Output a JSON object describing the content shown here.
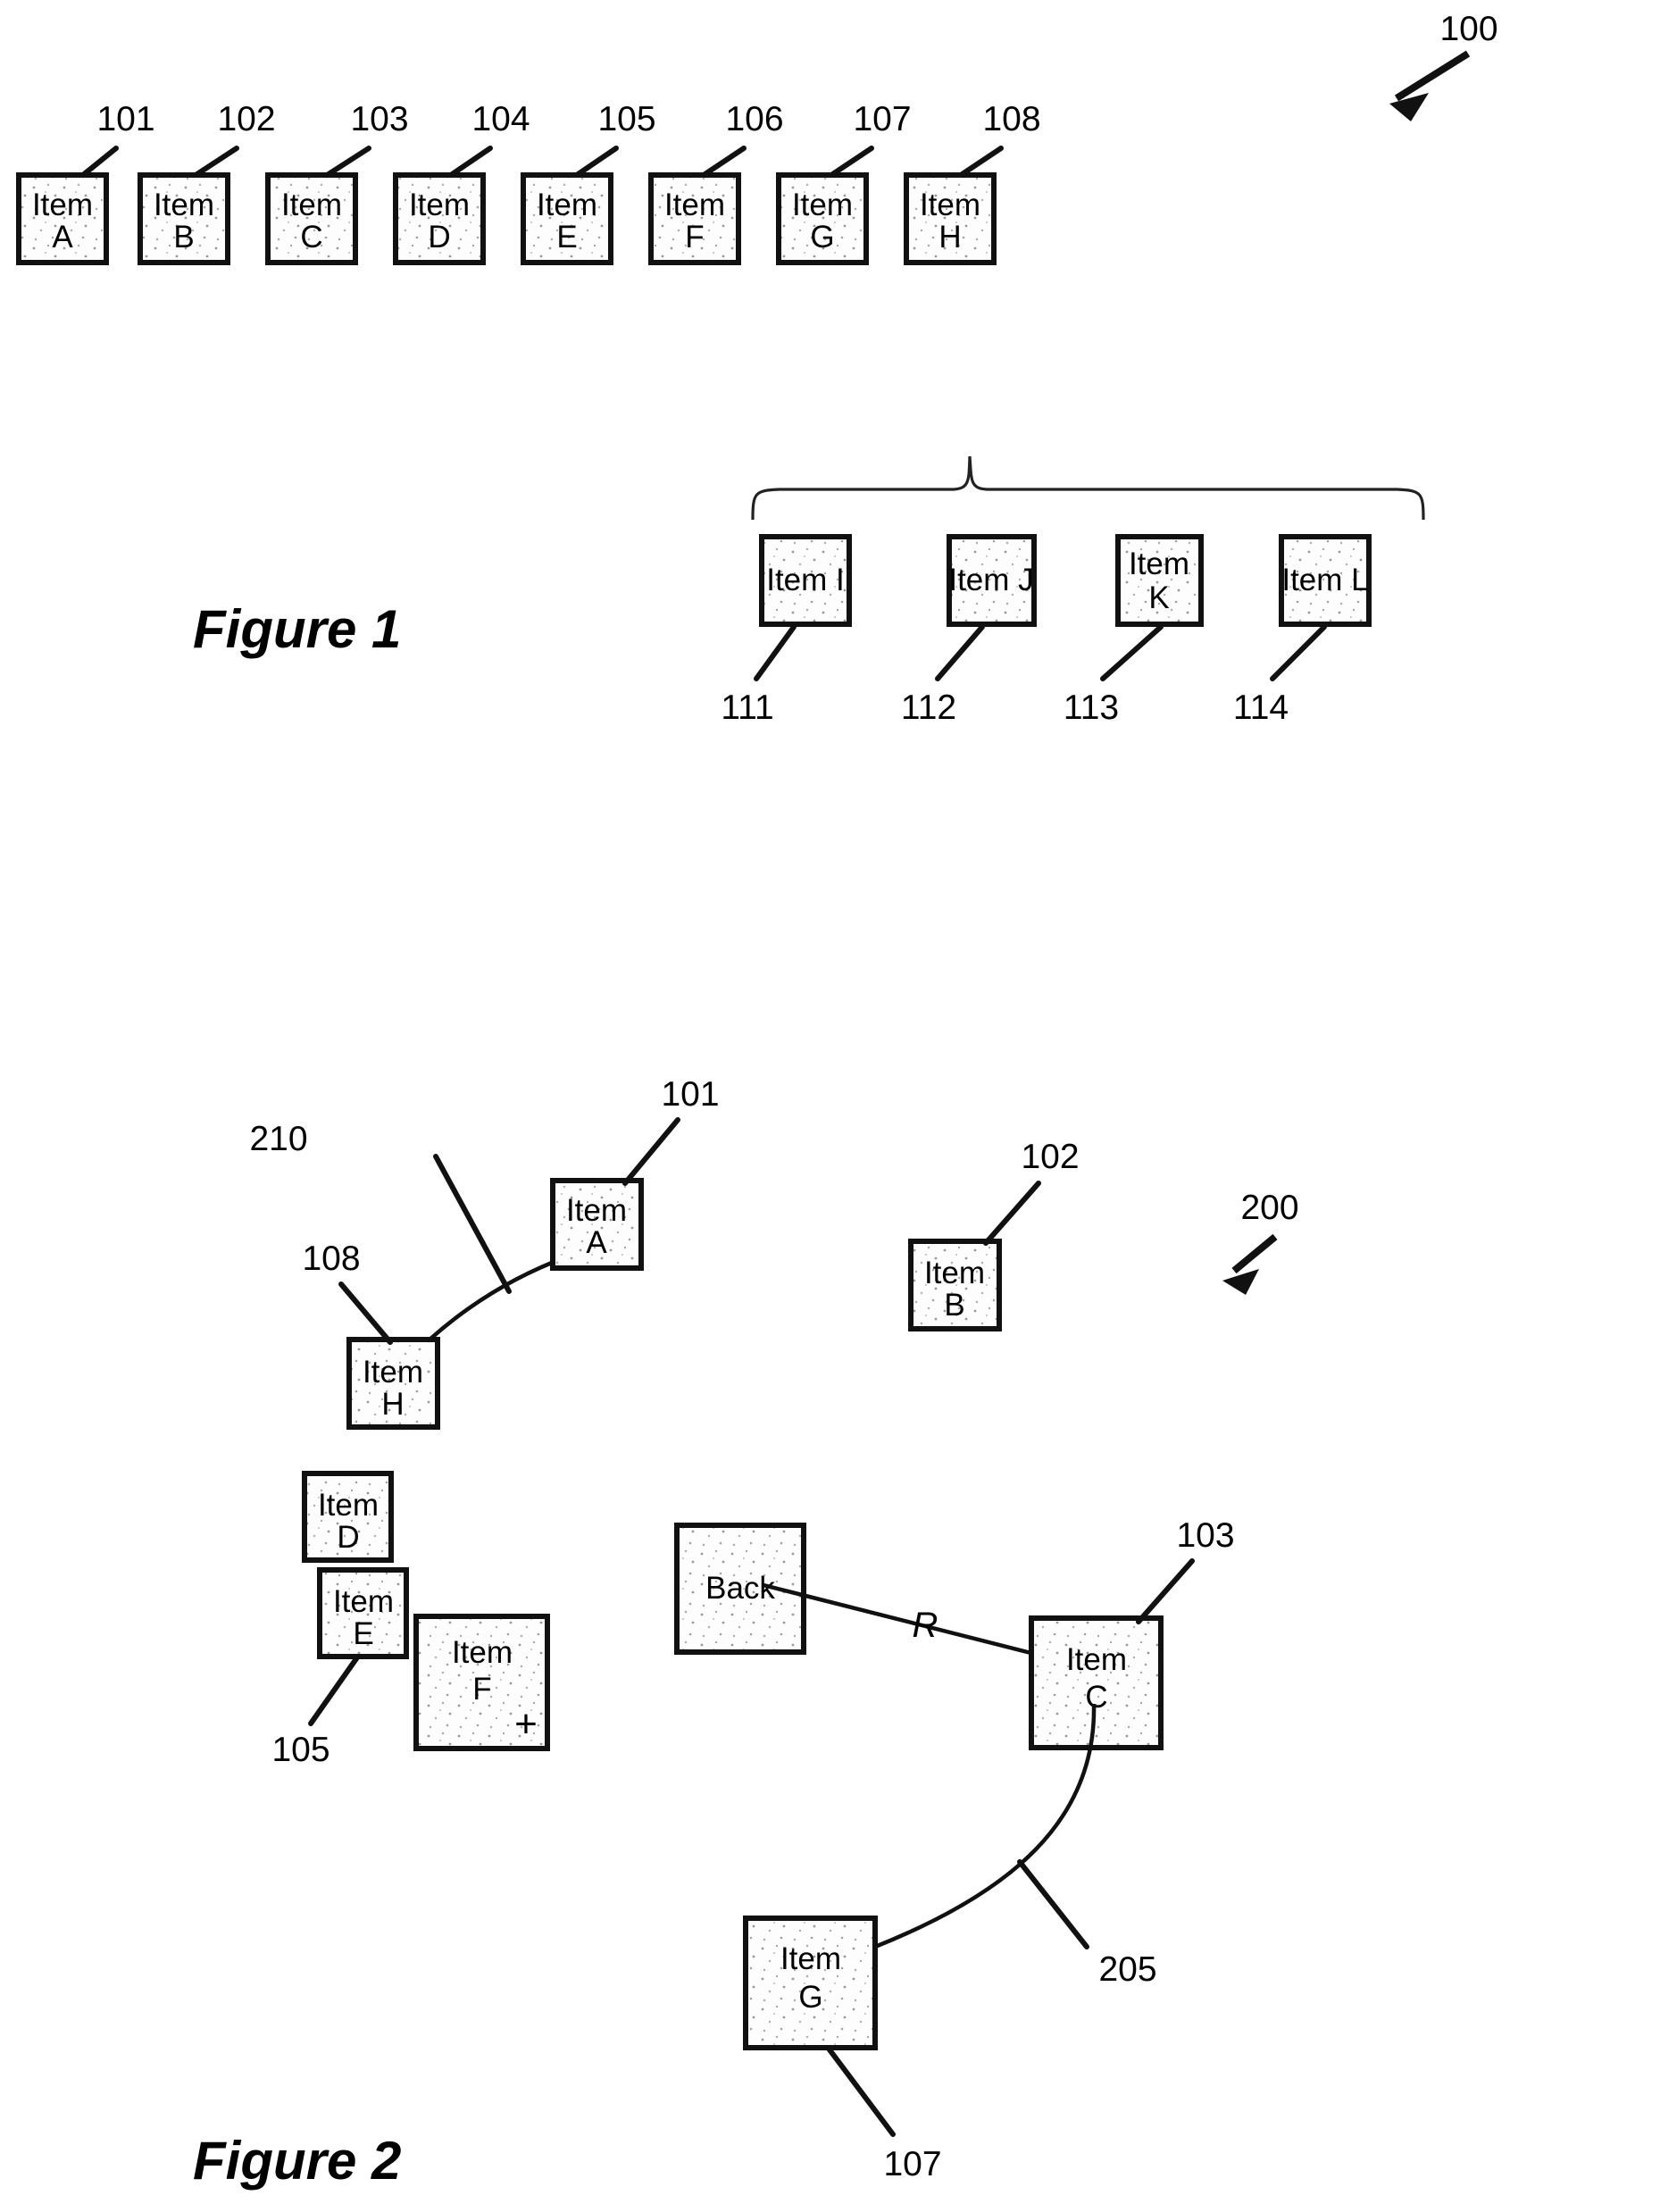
{
  "document": {
    "kind": "patent-figure-sheet",
    "figures": [
      {
        "caption": "Figure 1",
        "ref": "100"
      },
      {
        "caption": "Figure 2",
        "ref": "200"
      }
    ]
  },
  "figure1": {
    "caption": "Figure 1",
    "overall_ref": "100",
    "top_row": [
      {
        "ref": "101",
        "line1": "Item",
        "line2": "A"
      },
      {
        "ref": "102",
        "line1": "Item",
        "line2": "B"
      },
      {
        "ref": "103",
        "line1": "Item",
        "line2": "C"
      },
      {
        "ref": "104",
        "line1": "Item",
        "line2": "D"
      },
      {
        "ref": "105",
        "line1": "Item",
        "line2": "E"
      },
      {
        "ref": "106",
        "line1": "Item",
        "line2": "F"
      },
      {
        "ref": "107",
        "line1": "Item",
        "line2": "G"
      },
      {
        "ref": "108",
        "line1": "Item",
        "line2": "H"
      }
    ],
    "expanded_group": {
      "parent_ref": "106",
      "parent_item": "Item F",
      "children": [
        {
          "ref": "111",
          "line1": "Item I",
          "line2": ""
        },
        {
          "ref": "112",
          "line1": "Item J",
          "line2": ""
        },
        {
          "ref": "113",
          "line1": "Item",
          "line2": "K"
        },
        {
          "ref": "114",
          "line1": "Item L",
          "line2": ""
        }
      ]
    }
  },
  "figure2": {
    "caption": "Figure 2",
    "overall_ref": "200",
    "boxes": [
      {
        "ref": "101",
        "line1": "Item",
        "line2": "A"
      },
      {
        "ref": "102",
        "line1": "Item",
        "line2": "B"
      },
      {
        "ref": "108",
        "line1": "Item",
        "line2": "H"
      },
      {
        "ref": "",
        "line1": "Item",
        "line2": "D"
      },
      {
        "ref": "105",
        "line1": "Item",
        "line2": "E"
      },
      {
        "ref": "",
        "line1": "Item",
        "line2": "F",
        "badge": "+"
      },
      {
        "ref": "",
        "line1": "Back",
        "line2": ""
      },
      {
        "ref": "103",
        "line1": "Item",
        "line2": "C"
      },
      {
        "ref": "107",
        "line1": "Item",
        "line2": "G"
      }
    ],
    "connections": [
      {
        "ref": "210",
        "from": "Item H",
        "to": "Item A",
        "label": ""
      },
      {
        "ref": "",
        "from": "Back",
        "to": "Item C",
        "label": "R"
      },
      {
        "ref": "205",
        "from": "Item G",
        "to": "Item C",
        "label": ""
      }
    ]
  }
}
